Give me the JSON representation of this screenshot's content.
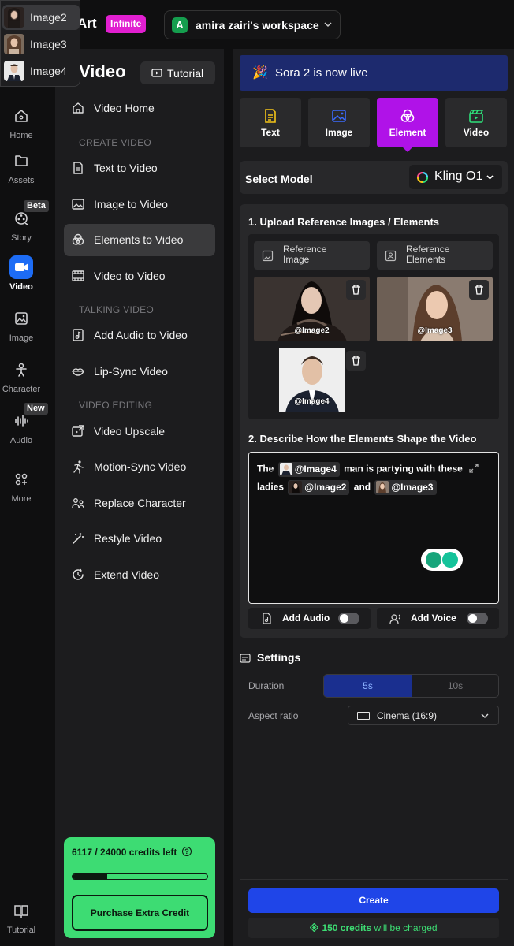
{
  "header": {
    "brand": "Art",
    "plan_badge": "Infinite",
    "workspace": {
      "initial": "A",
      "name": "amira zairi's workspace"
    }
  },
  "mention_dropdown": {
    "items": [
      {
        "label": "Image2",
        "selected": true
      },
      {
        "label": "Image3",
        "selected": false
      },
      {
        "label": "Image4",
        "selected": false
      }
    ]
  },
  "rail": {
    "items": [
      {
        "label": "Home",
        "icon": "home-icon"
      },
      {
        "label": "Assets",
        "icon": "folder-icon"
      },
      {
        "label": "Story",
        "icon": "film-reel-icon",
        "badge": "Beta"
      },
      {
        "label": "Video",
        "icon": "video-camera-icon",
        "active": true
      },
      {
        "label": "Image",
        "icon": "image-icon"
      },
      {
        "label": "Character",
        "icon": "character-icon"
      },
      {
        "label": "Audio",
        "icon": "audio-wave-icon",
        "badge": "New"
      },
      {
        "label": "More",
        "icon": "more-grid-icon"
      }
    ],
    "tutorial_label": "Tutorial"
  },
  "nav": {
    "title": "Video",
    "tutorial_button": "Tutorial",
    "home": "Video Home",
    "sections": {
      "create": "CREATE VIDEO",
      "talking": "TALKING VIDEO",
      "editing": "VIDEO EDITING"
    },
    "items": {
      "text_to_video": "Text to Video",
      "image_to_video": "Image to Video",
      "elements_to_video": "Elements to Video",
      "video_to_video": "Video to Video",
      "add_audio": "Add Audio to Video",
      "lip_sync": "Lip-Sync Video",
      "upscale": "Video Upscale",
      "motion_sync": "Motion-Sync Video",
      "replace_character": "Replace Character",
      "restyle": "Restyle Video",
      "extend": "Extend Video"
    },
    "credits": {
      "text": "6117 / 24000 credits left",
      "used_fraction": 0.2549,
      "purchase_button": "Purchase Extra Credit"
    }
  },
  "main": {
    "banner": "Sora 2 is now live",
    "tabs": [
      {
        "label": "Text",
        "icon": "text-doc-icon"
      },
      {
        "label": "Image",
        "icon": "image-icon"
      },
      {
        "label": "Element",
        "icon": "element-icon",
        "active": true
      },
      {
        "label": "Video",
        "icon": "clapper-icon"
      }
    ],
    "model": {
      "label": "Select Model",
      "value": "Kling O1"
    },
    "upload": {
      "title": "1. Upload Reference Images / Elements",
      "ref_image": "Reference Image",
      "ref_elements": "Reference Elements",
      "images": [
        {
          "tag": "@Image2"
        },
        {
          "tag": "@Image3"
        },
        {
          "tag": "@Image4"
        }
      ]
    },
    "describe": {
      "title": "2. Describe How the Elements Shape the Video",
      "prompt": {
        "w1": "The",
        "chip1": "@Image4",
        "w2": "man is partying with these",
        "w3": "ladies",
        "chip2": "@Image2",
        "w4": "and",
        "chip3": "@Image3"
      }
    },
    "add_audio": "Add Audio",
    "add_voice": "Add Voice",
    "settings": {
      "title": "Settings",
      "duration_label": "Duration",
      "duration_options": [
        "5s",
        "10s"
      ],
      "duration_selected": "5s",
      "aspect_label": "Aspect ratio",
      "aspect_value": "Cinema (16:9)"
    },
    "create_button": "Create",
    "charge": {
      "amount": "150 credits",
      "suffix": " will be charged"
    }
  }
}
